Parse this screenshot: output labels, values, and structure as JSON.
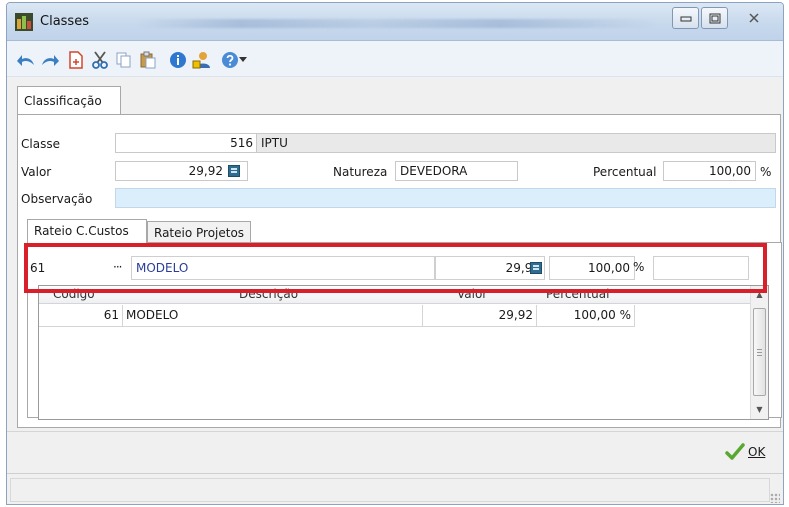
{
  "window": {
    "title": "Classes"
  },
  "toolbar": {
    "icons": [
      "undo-icon",
      "redo-icon",
      "new-document-icon",
      "cut-icon",
      "copy-icon",
      "paste-icon",
      "info-icon",
      "user-icon",
      "help-icon",
      "dropdown-arrow-icon"
    ]
  },
  "tabs": {
    "main": "Classificação",
    "rateio_custos": "Rateio C.Custos",
    "rateio_projetos": "Rateio Projetos"
  },
  "form": {
    "classe_label": "Classe",
    "classe_code": "516",
    "classe_desc": "IPTU",
    "valor_label": "Valor",
    "valor_value": "29,92",
    "natureza_label": "Natureza",
    "natureza_value": "DEVEDORA",
    "percentual_label": "Percentual",
    "percentual_value": "100,00",
    "percent_sign": "%",
    "observacao_label": "Observação",
    "observacao_value": ""
  },
  "edit_row": {
    "codigo": "61",
    "ellipsis": "···",
    "descricao": "MODELO",
    "valor": "29,92",
    "percentual": "100,00",
    "percent_sign": "%",
    "extra": ""
  },
  "grid": {
    "headers": {
      "codigo": "Codigo",
      "descricao": "Descrição",
      "valor": "Valor",
      "percentual": "Percentual"
    },
    "rows": [
      {
        "codigo": "61",
        "descricao": "MODELO",
        "valor": "29,92",
        "percentual": "100,00 %"
      }
    ]
  },
  "footer": {
    "ok_label": "OK"
  },
  "colors": {
    "highlight_border": "#d81f2a",
    "observacao_bg": "#dbeefb",
    "ok_check": "#5aa832"
  }
}
